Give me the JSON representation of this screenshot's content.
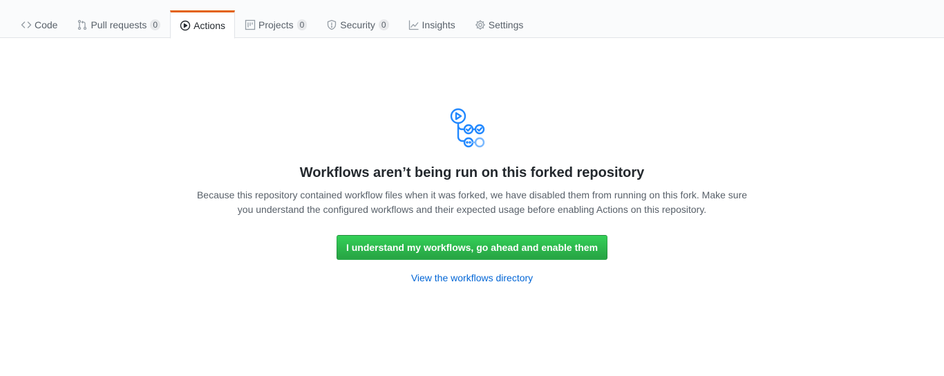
{
  "tabs": [
    {
      "label": "Code",
      "icon": "code-icon"
    },
    {
      "label": "Pull requests",
      "icon": "git-pull-request-icon",
      "count": "0"
    },
    {
      "label": "Actions",
      "icon": "play-icon",
      "active": true
    },
    {
      "label": "Projects",
      "icon": "project-icon",
      "count": "0"
    },
    {
      "label": "Security",
      "icon": "shield-icon",
      "count": "0"
    },
    {
      "label": "Insights",
      "icon": "graph-icon"
    },
    {
      "label": "Settings",
      "icon": "gear-icon"
    }
  ],
  "blank": {
    "icon": "workflow-icon",
    "title": "Workflows aren’t being run on this forked repository",
    "description": "Because this repository contained workflow files when it was forked, we have disabled them from running on this fork. Make sure you understand the configured workflows and their expected usage before enabling Actions on this repository.",
    "enable_button": "I understand my workflows, go ahead and enable them",
    "view_link": "View the workflows directory"
  },
  "colors": {
    "active_tab_accent": "#e36209",
    "primary_button": "#28a745",
    "link": "#0366d6",
    "workflow_icon": "#2188ff"
  }
}
